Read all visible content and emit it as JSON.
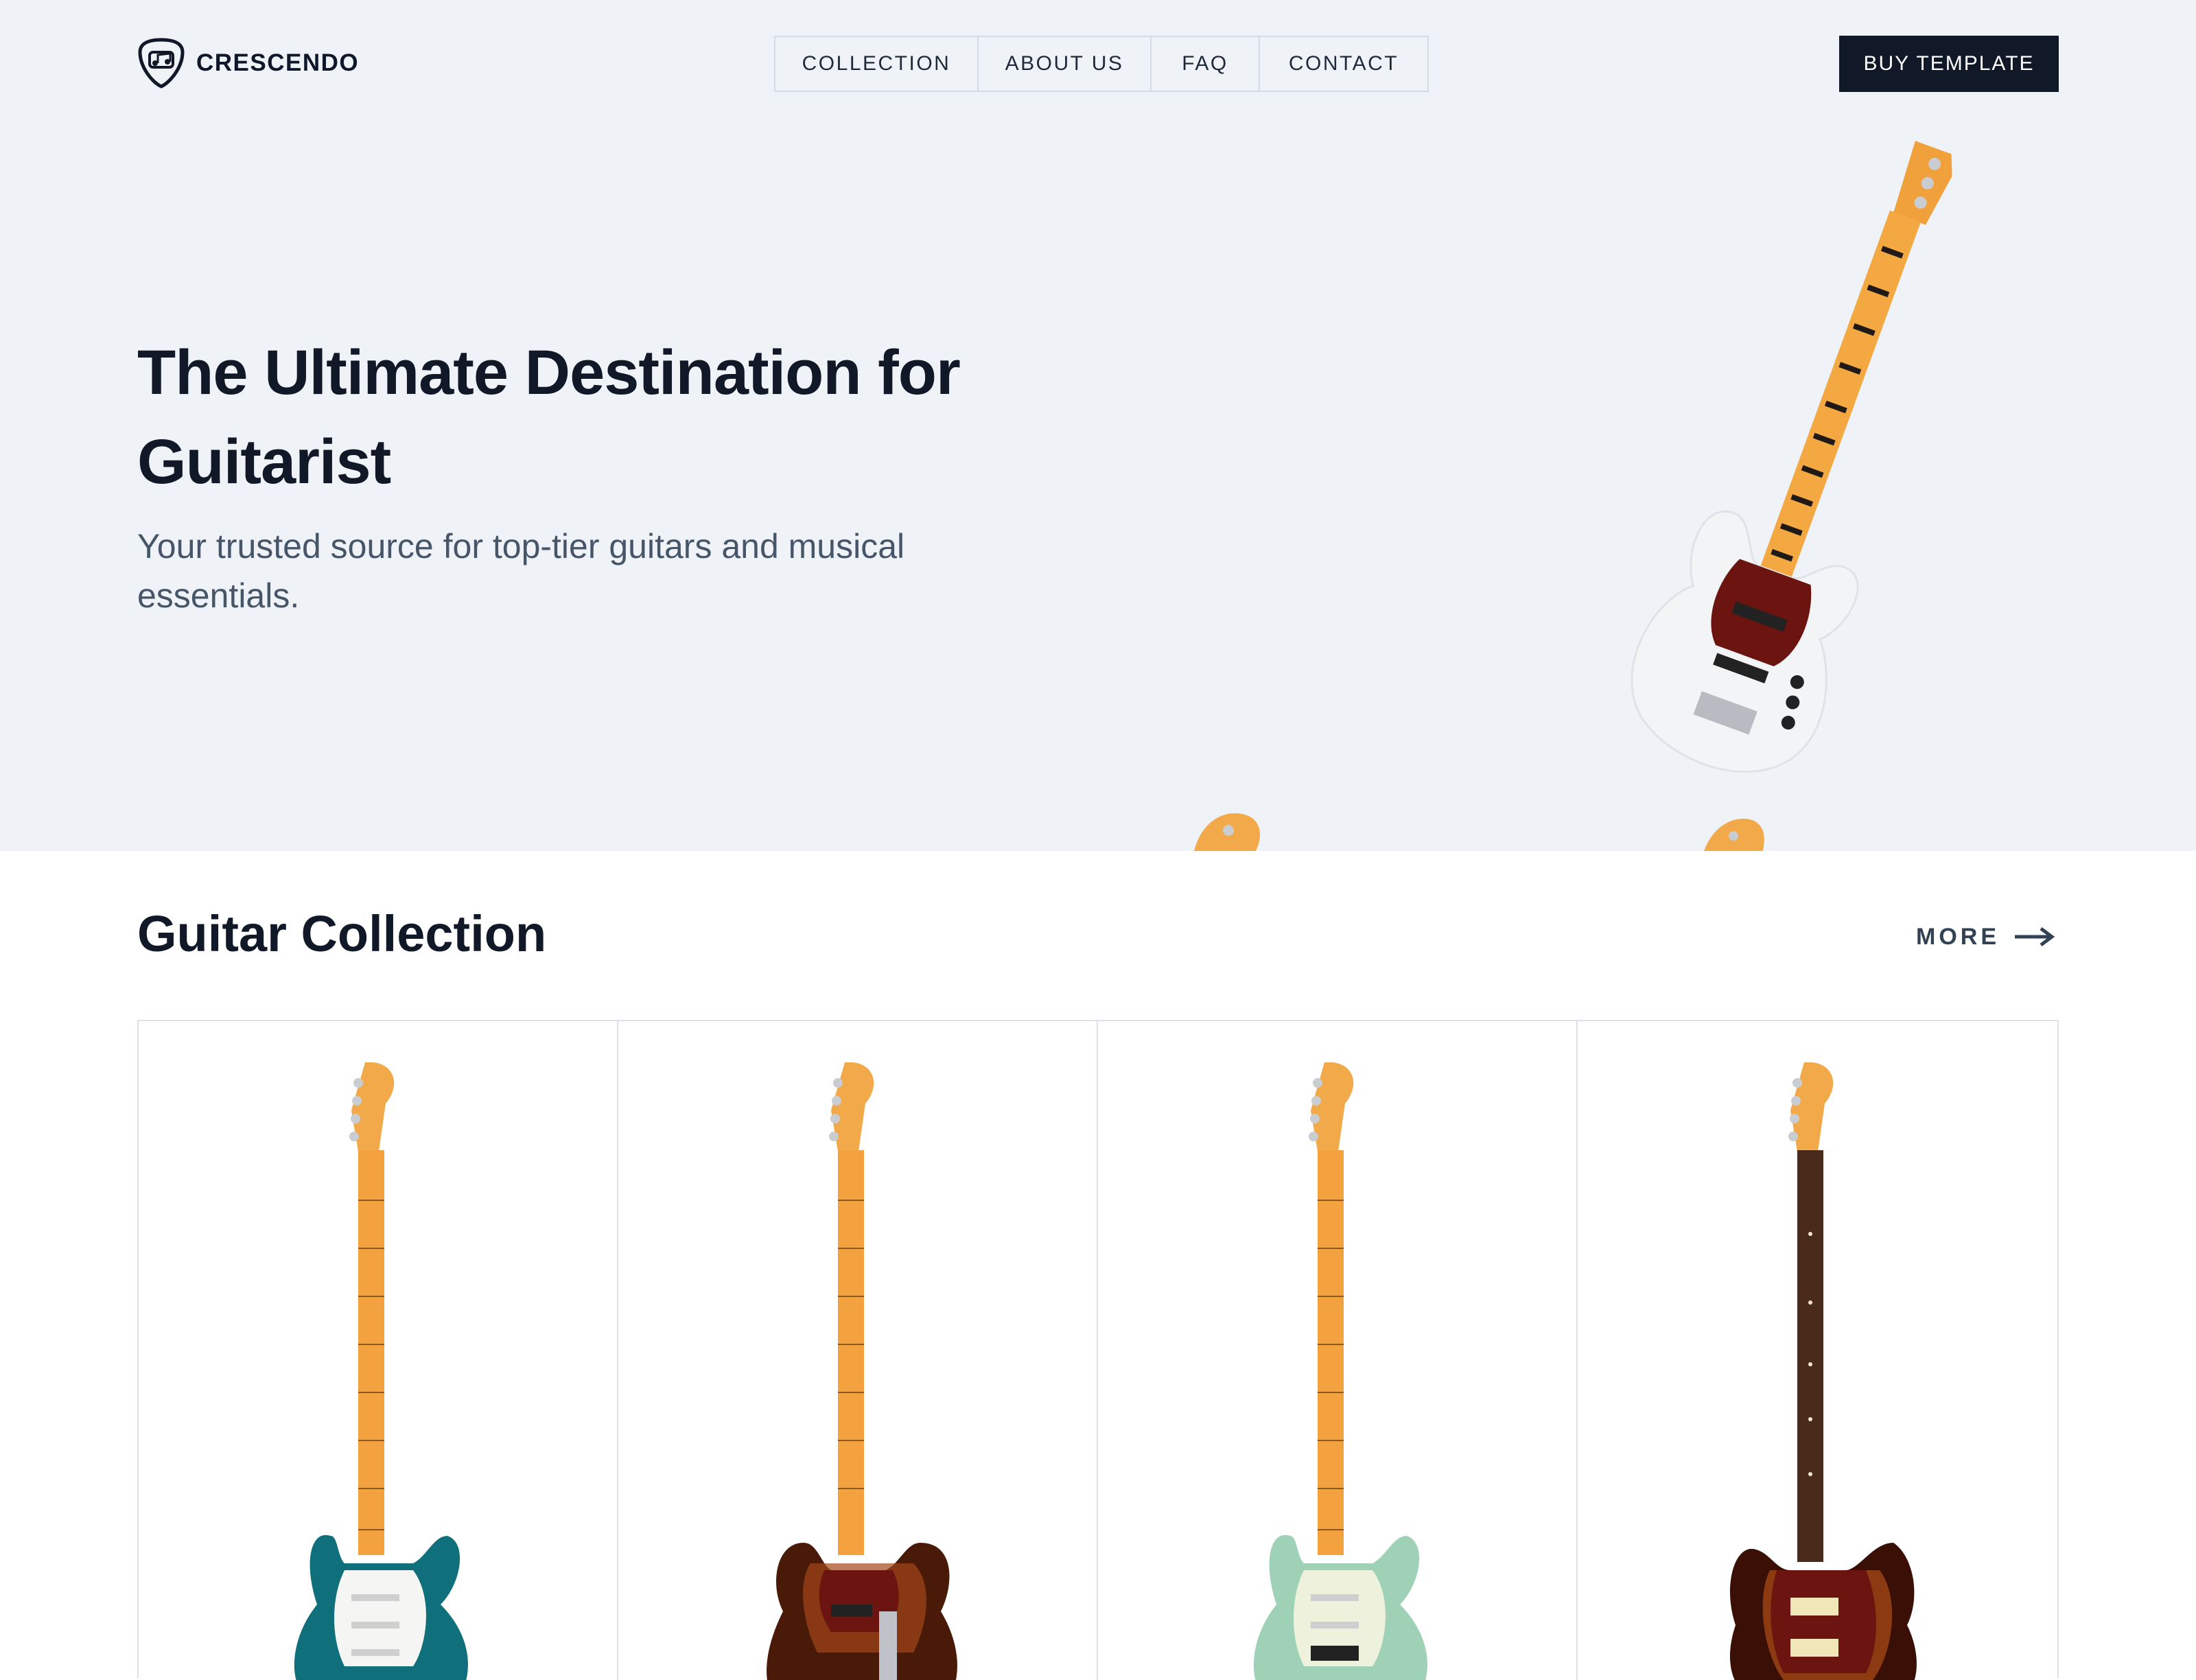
{
  "brand": {
    "name": "CRESCENDO",
    "logo_icon": "guitar-pick-logo"
  },
  "nav": {
    "items": [
      {
        "label": "COLLECTION"
      },
      {
        "label": "ABOUT US"
      },
      {
        "label": "FAQ"
      },
      {
        "label": "CONTACT"
      }
    ]
  },
  "cta": {
    "label": "BUY TEMPLATE"
  },
  "hero": {
    "title": "The Ultimate Destination for Guitarist",
    "subtitle": "Your trusted source for top-tier guitars and musical essentials."
  },
  "collection": {
    "title": "Guitar Collection",
    "more_label": "MORE",
    "more_icon": "arrow-right-icon",
    "items": [
      {
        "image": "teal-stratocaster-guitar",
        "body_color": "#0f6f7a"
      },
      {
        "image": "sunburst-telecaster-guitar",
        "body_color": "#6b2a0c"
      },
      {
        "image": "seafoam-stratocaster-guitar",
        "body_color": "#9fd1b6"
      },
      {
        "image": "sunburst-jazzmaster-guitar",
        "body_color": "#5a1a08"
      }
    ]
  },
  "colors": {
    "hero_bg": "#eff3f8",
    "dark": "#111827",
    "border": "#d5dbe3",
    "maple": "#f2a94a"
  }
}
